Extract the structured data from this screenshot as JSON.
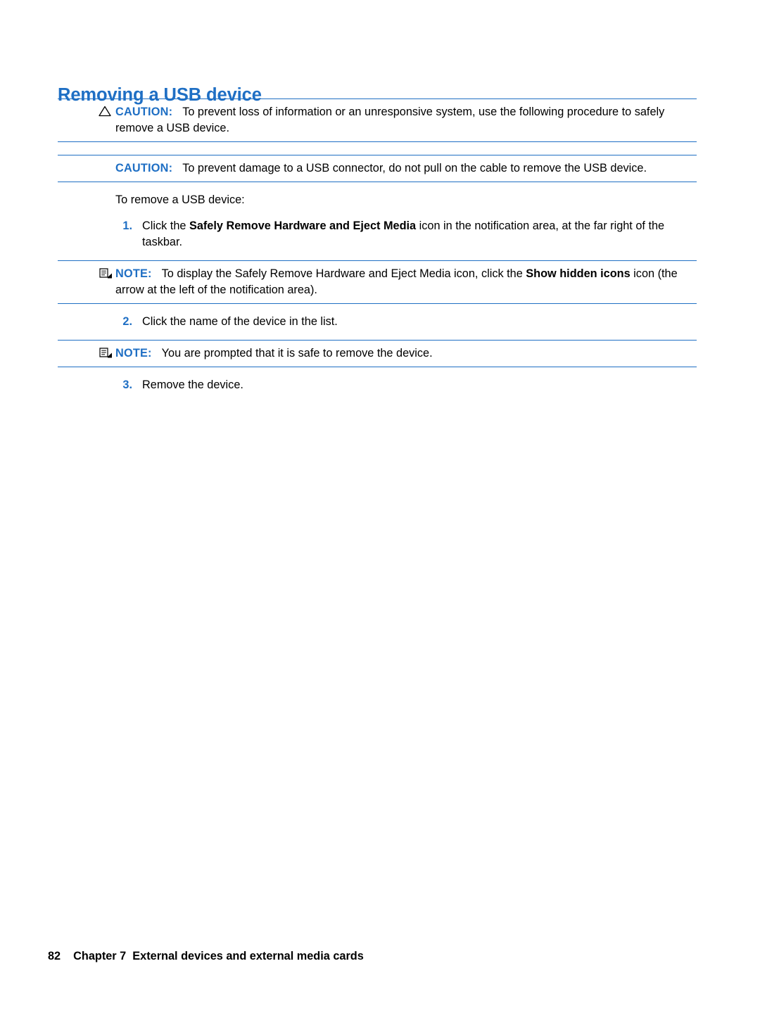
{
  "document": {
    "title": "Removing a USB device",
    "caution1": {
      "label": "CAUTION:",
      "text": "To prevent loss of information or an unresponsive system, use the following procedure to safely remove a USB device."
    },
    "caution2": {
      "label": "CAUTION:",
      "text": "To prevent damage to a USB connector, do not pull on the cable to remove the USB device."
    },
    "intro": "To remove a USB device:",
    "steps": [
      {
        "num": "1.",
        "text_before": "Click the ",
        "bold": "Safely Remove Hardware and Eject Media",
        "text_after": " icon in the notification area, at the far right of the taskbar."
      },
      {
        "num": "2.",
        "text_before": "Click the name of the device in the list.",
        "bold": "",
        "text_after": ""
      },
      {
        "num": "3.",
        "text_before": "Remove the device.",
        "bold": "",
        "text_after": ""
      }
    ],
    "note1": {
      "label": "NOTE:",
      "text_before": "To display the Safely Remove Hardware and Eject Media icon, click the ",
      "bold": "Show hidden icons",
      "text_after": " icon (the arrow at the left of the notification area)."
    },
    "note2": {
      "label": "NOTE:",
      "text_before": "You are prompted that it is safe to remove the device.",
      "bold": "",
      "text_after": ""
    },
    "footer": {
      "page_number": "82",
      "chapter_label": "Chapter 7",
      "chapter_title": "External devices and external media cards"
    },
    "colors": {
      "accent": "#1f6fc4",
      "text": "#000000"
    }
  }
}
